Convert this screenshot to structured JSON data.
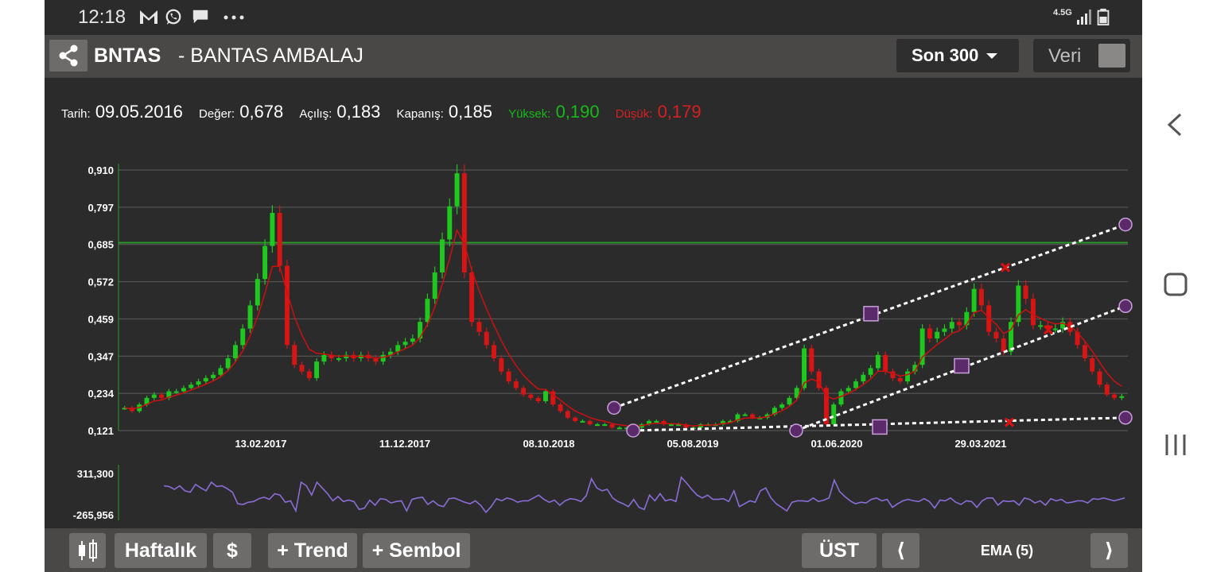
{
  "status": {
    "time": "12:18",
    "network": "4.5G"
  },
  "header": {
    "symbol": "BNTAS",
    "company": "- BANTAS AMBALAJ",
    "range_label": "Son 300",
    "data_label": "Veri"
  },
  "info": {
    "tarih_label": "Tarih:",
    "tarih": "09.05.2016",
    "deger_label": "Değer:",
    "deger": "0,678",
    "acilis_label": "Açılış:",
    "acilis": "0,183",
    "kapanis_label": "Kapanış:",
    "kapanis": "0,185",
    "yuksek_label": "Yüksek:",
    "yuksek": "0,190",
    "dusuk_label": "Düşük:",
    "dusuk": "0,179"
  },
  "toolbar": {
    "period_label": "Haftalık",
    "currency_label": "$",
    "trend_label": "+ Trend",
    "symbol_label": "+ Sembol",
    "ust_label": "ÜST",
    "prev_label": "⟨",
    "indicator_label": "EMA (5)",
    "next_label": "⟩"
  },
  "chart_data": {
    "type": "candlestick",
    "y_ticks": [
      "0,910",
      "0,797",
      "0,685",
      "0,572",
      "0,459",
      "0,347",
      "0,234",
      "0,121"
    ],
    "ylim": [
      0.121,
      0.91
    ],
    "x_ticks": [
      "13.02.2017",
      "11.12.2017",
      "08.10.2018",
      "05.08.2019",
      "01.06.2020",
      "29.03.2021"
    ],
    "grid": true,
    "horizontal_line": 0.69,
    "close_series": [
      0.19,
      0.18,
      0.2,
      0.22,
      0.23,
      0.22,
      0.24,
      0.24,
      0.25,
      0.26,
      0.27,
      0.28,
      0.29,
      0.31,
      0.34,
      0.38,
      0.43,
      0.5,
      0.58,
      0.68,
      0.78,
      0.62,
      0.38,
      0.32,
      0.3,
      0.28,
      0.33,
      0.35,
      0.34,
      0.34,
      0.35,
      0.34,
      0.35,
      0.34,
      0.33,
      0.35,
      0.36,
      0.38,
      0.39,
      0.4,
      0.45,
      0.52,
      0.6,
      0.7,
      0.8,
      0.9,
      0.6,
      0.45,
      0.42,
      0.38,
      0.34,
      0.3,
      0.27,
      0.25,
      0.23,
      0.22,
      0.21,
      0.24,
      0.2,
      0.18,
      0.16,
      0.15,
      0.15,
      0.14,
      0.14,
      0.14,
      0.13,
      0.13,
      0.13,
      0.13,
      0.14,
      0.15,
      0.15,
      0.14,
      0.14,
      0.14,
      0.13,
      0.13,
      0.14,
      0.14,
      0.14,
      0.15,
      0.15,
      0.17,
      0.17,
      0.16,
      0.16,
      0.17,
      0.19,
      0.2,
      0.22,
      0.25,
      0.37,
      0.3,
      0.25,
      0.14,
      0.2,
      0.24,
      0.25,
      0.27,
      0.29,
      0.31,
      0.35,
      0.3,
      0.28,
      0.27,
      0.3,
      0.32,
      0.43,
      0.4,
      0.42,
      0.43,
      0.45,
      0.44,
      0.48,
      0.55,
      0.5,
      0.42,
      0.4,
      0.36,
      0.45,
      0.56,
      0.52,
      0.44,
      0.44,
      0.43,
      0.43,
      0.45,
      0.42,
      0.38,
      0.34,
      0.3,
      0.26,
      0.23,
      0.22,
      0.225
    ],
    "indicator": {
      "name": "EMA (5)",
      "ylim": [
        -265.956,
        311.3
      ],
      "y_ticks": [
        "311,300",
        "-265,956"
      ]
    },
    "oscillator_series": [
      150,
      140,
      100,
      150,
      80,
      60,
      170,
      120,
      80,
      200,
      140,
      150,
      110,
      60,
      -100,
      -110,
      -80,
      -70,
      -30,
      -10,
      -40,
      40,
      20,
      -80,
      -60,
      -200,
      200,
      150,
      20,
      200,
      120,
      40,
      -60,
      0,
      -70,
      -50,
      -70,
      -180,
      -160,
      -50,
      -120,
      -30,
      -40,
      -90,
      -70,
      -60,
      -200,
      -40,
      -20,
      -10,
      -110,
      -60,
      -120,
      -140,
      -30,
      -20,
      -50,
      -80,
      -100,
      -60,
      -120,
      -220,
      -140,
      -30,
      -60,
      -20,
      -40,
      -80,
      -60,
      -60,
      -20,
      20,
      -40,
      -80,
      -50,
      -120,
      -60,
      -30,
      -40,
      -70,
      10,
      250,
      120,
      80,
      100,
      -20,
      -70,
      -100,
      -140,
      -40,
      -150,
      -180,
      20,
      -60,
      40,
      -60,
      -40,
      -70,
      270,
      190,
      100,
      20,
      -20,
      20,
      -40,
      -40,
      -30,
      -70,
      80,
      -140,
      -100,
      -60,
      -80,
      80,
      120,
      -20,
      -100,
      -150,
      -200,
      -80,
      -60,
      -60,
      -70,
      -20,
      -70,
      -50,
      -20,
      230,
      70,
      0,
      -60,
      -100,
      -80,
      -90,
      -40,
      -20,
      -60,
      -40,
      -150,
      -100,
      -60,
      -40,
      -60,
      -70,
      -30,
      -70,
      -160,
      -50,
      -60,
      -20,
      -80,
      -110,
      -60,
      -70,
      -150,
      -60,
      -20,
      -20,
      -120,
      -60,
      -70,
      -60,
      -120,
      -20,
      -40,
      -90,
      -60,
      -120,
      -30,
      -60,
      -40,
      -90,
      -80,
      -60,
      -60,
      -90,
      -30,
      -40,
      -20,
      -40,
      -60,
      -40,
      -20
    ]
  },
  "colors": {
    "up": "#1fc81f",
    "down": "#d81515",
    "ema": "#cc1010",
    "oscillator": "#8a6dd6",
    "marker": "#5a2a6a",
    "trend": "#ffffff",
    "level": "#2a9a2a",
    "grid": "#5c5c5c"
  }
}
